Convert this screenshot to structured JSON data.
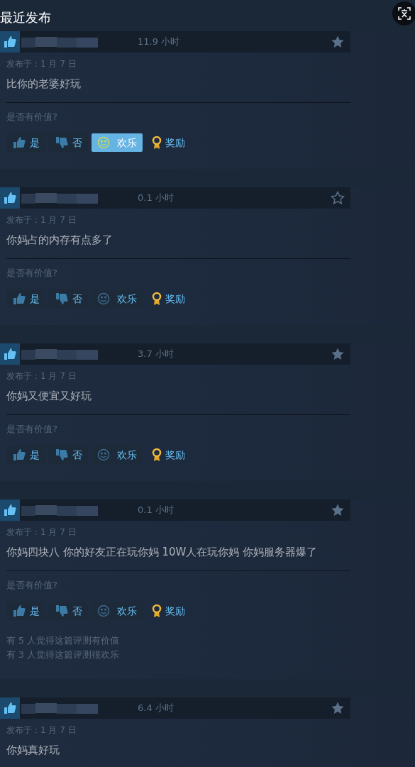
{
  "heading": "最近发布",
  "reviews": [
    {
      "hours": "11.9 小时",
      "starred": true,
      "date": "发布于：1 月 7 日",
      "text": "比你的老婆好玩",
      "question": "是否有价值?",
      "buttons": [
        {
          "kind": "yes",
          "label": "是",
          "selected": false
        },
        {
          "kind": "no",
          "label": "否",
          "selected": false
        },
        {
          "kind": "funny",
          "label": "欢乐",
          "selected": true
        },
        {
          "kind": "award",
          "label": "奖励",
          "selected": false
        }
      ]
    },
    {
      "hours": "0.1 小时",
      "starred": false,
      "date": "发布于：1 月 7 日",
      "text": "你妈占的内存有点多了",
      "question": "是否有价值?",
      "buttons": [
        {
          "kind": "yes",
          "label": "是",
          "selected": false
        },
        {
          "kind": "no",
          "label": "否",
          "selected": false
        },
        {
          "kind": "funny",
          "label": "欢乐",
          "selected": false
        },
        {
          "kind": "award",
          "label": "奖励",
          "selected": false
        }
      ]
    },
    {
      "hours": "3.7 小时",
      "starred": true,
      "date": "发布于：1 月 7 日",
      "text": "你妈又便宜又好玩",
      "question": "是否有价值?",
      "buttons": [
        {
          "kind": "yes",
          "label": "是",
          "selected": false
        },
        {
          "kind": "no",
          "label": "否",
          "selected": false
        },
        {
          "kind": "funny",
          "label": "欢乐",
          "selected": false
        },
        {
          "kind": "award",
          "label": "奖励",
          "selected": false
        }
      ]
    },
    {
      "hours": "0.1 小时",
      "starred": true,
      "date": "发布于：1 月 7 日",
      "text": "你妈四块八 你的好友正在玩你妈 10W人在玩你妈 你妈服务器爆了",
      "question": "是否有价值?",
      "buttons": [
        {
          "kind": "yes",
          "label": "是",
          "selected": false
        },
        {
          "kind": "no",
          "label": "否",
          "selected": false
        },
        {
          "kind": "funny",
          "label": "欢乐",
          "selected": false
        },
        {
          "kind": "award",
          "label": "奖励",
          "selected": false
        }
      ],
      "summary": [
        "有 5 人觉得这篇评测有价值",
        "有 3 人觉得这篇评测很欢乐"
      ]
    },
    {
      "hours": "6.4 小时",
      "starred": true,
      "date": "发布于：1 月 7 日",
      "text": "你妈真好玩"
    }
  ]
}
